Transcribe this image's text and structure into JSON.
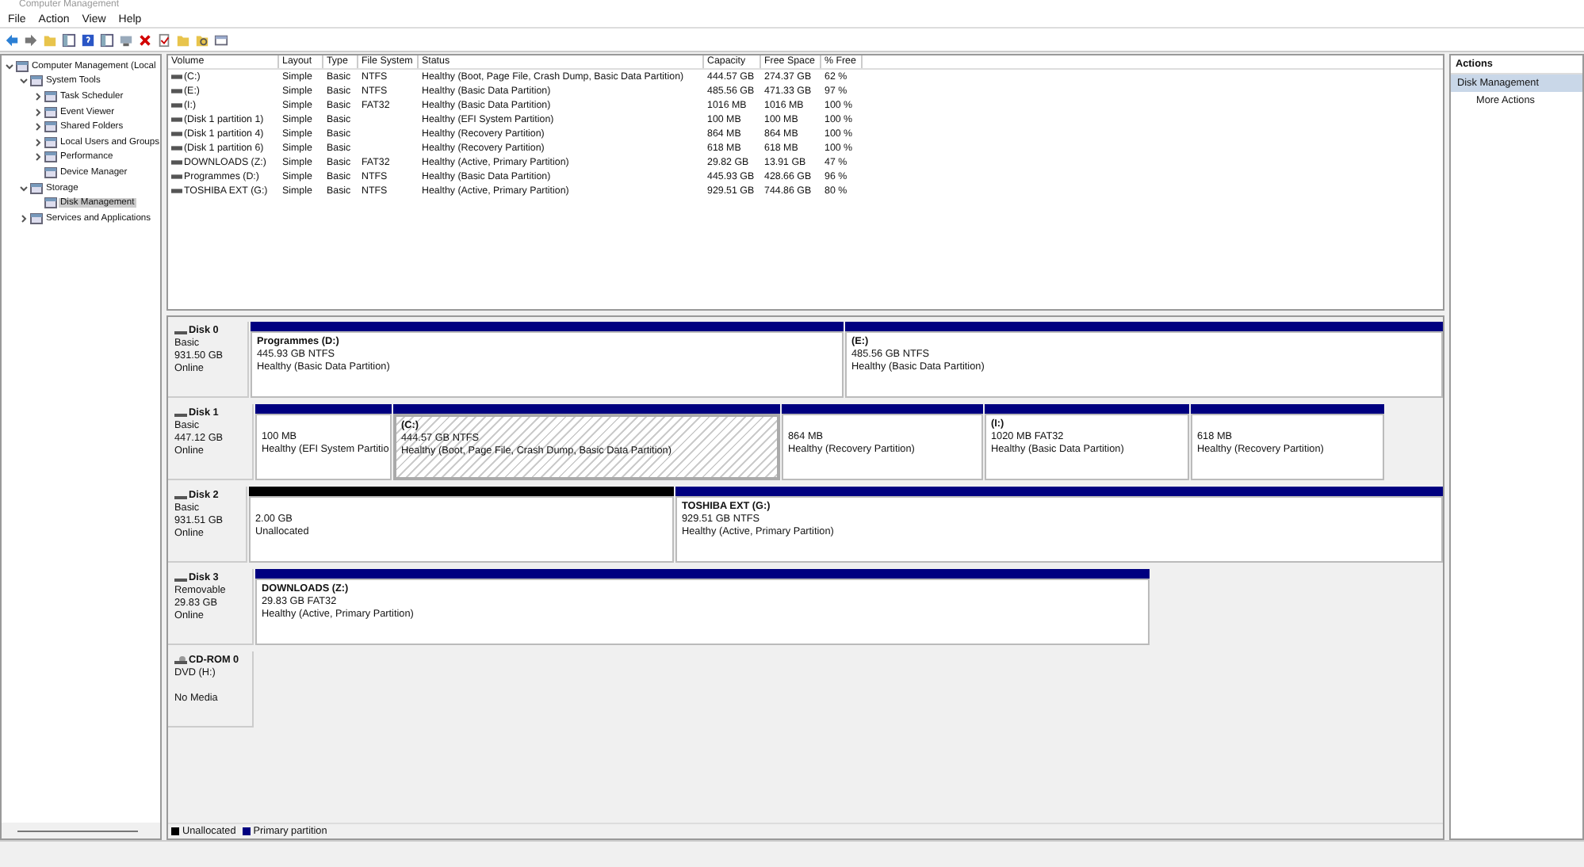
{
  "window": {
    "title": "Computer Management"
  },
  "menu": [
    "File",
    "Action",
    "View",
    "Help"
  ],
  "tree": [
    {
      "label": "Computer Management (Local",
      "expanded": true,
      "selected": false,
      "children": [
        {
          "label": "System Tools",
          "expanded": true,
          "selected": false,
          "children": [
            {
              "label": "Task Scheduler",
              "expanded": false,
              "selected": false
            },
            {
              "label": "Event Viewer",
              "expanded": false,
              "selected": false
            },
            {
              "label": "Shared Folders",
              "expanded": false,
              "selected": false
            },
            {
              "label": "Local Users and Groups",
              "expanded": false,
              "selected": false
            },
            {
              "label": "Performance",
              "expanded": false,
              "selected": false
            },
            {
              "label": "Device Manager",
              "selected": false
            }
          ]
        },
        {
          "label": "Storage",
          "expanded": true,
          "selected": false,
          "children": [
            {
              "label": "Disk Management",
              "selected": true
            }
          ]
        },
        {
          "label": "Services and Applications",
          "expanded": false,
          "selected": false
        }
      ]
    }
  ],
  "volumes": {
    "columns": [
      "Volume",
      "Layout",
      "Type",
      "File System",
      "Status",
      "Capacity",
      "Free Space",
      "% Free"
    ],
    "rows": [
      {
        "volume": "(C:)",
        "layout": "Simple",
        "type": "Basic",
        "file_system": "NTFS",
        "status": "Healthy (Boot, Page File, Crash Dump, Basic Data Partition)",
        "capacity": "444.57 GB",
        "free_space": "274.37 GB",
        "percent_free": "62 %"
      },
      {
        "volume": "(E:)",
        "layout": "Simple",
        "type": "Basic",
        "file_system": "NTFS",
        "status": "Healthy (Basic Data Partition)",
        "capacity": "485.56 GB",
        "free_space": "471.33 GB",
        "percent_free": "97 %"
      },
      {
        "volume": "(I:)",
        "layout": "Simple",
        "type": "Basic",
        "file_system": "FAT32",
        "status": "Healthy (Basic Data Partition)",
        "capacity": "1016 MB",
        "free_space": "1016 MB",
        "percent_free": "100 %"
      },
      {
        "volume": "(Disk 1 partition 1)",
        "layout": "Simple",
        "type": "Basic",
        "status": "Healthy (EFI System Partition)",
        "capacity": "100 MB",
        "free_space": "100 MB",
        "percent_free": "100 %"
      },
      {
        "volume": "(Disk 1 partition 4)",
        "layout": "Simple",
        "type": "Basic",
        "status": "Healthy (Recovery Partition)",
        "capacity": "864 MB",
        "free_space": "864 MB",
        "percent_free": "100 %"
      },
      {
        "volume": "(Disk 1 partition 6)",
        "layout": "Simple",
        "type": "Basic",
        "status": "Healthy (Recovery Partition)",
        "capacity": "618 MB",
        "free_space": "618 MB",
        "percent_free": "100 %"
      },
      {
        "volume": "DOWNLOADS (Z:)",
        "layout": "Simple",
        "type": "Basic",
        "file_system": "FAT32",
        "status": "Healthy (Active, Primary Partition)",
        "capacity": "29.82 GB",
        "free_space": "13.91 GB",
        "percent_free": "47 %"
      },
      {
        "volume": "Programmes (D:)",
        "layout": "Simple",
        "type": "Basic",
        "file_system": "NTFS",
        "status": "Healthy (Basic Data Partition)",
        "capacity": "445.93 GB",
        "free_space": "428.66 GB",
        "percent_free": "96 %"
      },
      {
        "volume": "TOSHIBA EXT (G:)",
        "layout": "Simple",
        "type": "Basic",
        "file_system": "NTFS",
        "status": "Healthy (Active, Primary Partition)",
        "capacity": "929.51 GB",
        "free_space": "744.86 GB",
        "percent_free": "80 %"
      }
    ]
  },
  "disks": [
    {
      "kind": "disk",
      "name": "Disk 0",
      "type": "Basic",
      "size": "931.50 GB",
      "status": "Online",
      "partitions": [
        {
          "kind": "primary",
          "selected": false,
          "name": "Programmes  (D:)",
          "size": "445.93 GB NTFS",
          "status": "Healthy (Basic Data Partition)"
        },
        {
          "kind": "primary",
          "selected": false,
          "name": "(E:)",
          "size": "485.56 GB NTFS",
          "status": "Healthy (Basic Data Partition)"
        }
      ]
    },
    {
      "kind": "disk",
      "name": "Disk 1",
      "type": "Basic",
      "size": "447.12 GB",
      "status": "Online",
      "partitions": [
        {
          "kind": "primary",
          "selected": false,
          "size": "100 MB",
          "status": "Healthy (EFI System Partitio"
        },
        {
          "kind": "primary",
          "selected": true,
          "name": "(C:)",
          "size": "444.57 GB NTFS",
          "status": "Healthy (Boot, Page File, Crash Dump, Basic Data Partition)"
        },
        {
          "kind": "primary",
          "selected": false,
          "size": "864 MB",
          "status": "Healthy (Recovery Partition)"
        },
        {
          "kind": "primary",
          "selected": false,
          "name": "(I:)",
          "size": "1020 MB FAT32",
          "status": "Healthy (Basic Data Partition)"
        },
        {
          "kind": "primary",
          "selected": false,
          "size": "618 MB",
          "status": "Healthy (Recovery Partition)"
        }
      ]
    },
    {
      "kind": "disk",
      "name": "Disk 2",
      "type": "Basic",
      "size": "931.51 GB",
      "status": "Online",
      "partitions": [
        {
          "kind": "unallocated",
          "selected": false,
          "size": "2.00 GB",
          "status": "Unallocated"
        },
        {
          "kind": "primary",
          "selected": false,
          "name": "TOSHIBA EXT  (G:)",
          "size": "929.51 GB NTFS",
          "status": "Healthy (Active, Primary Partition)"
        }
      ]
    },
    {
      "kind": "disk",
      "name": "Disk 3",
      "type": "Removable",
      "size": "29.83 GB",
      "status": "Online",
      "partitions": [
        {
          "kind": "primary",
          "selected": false,
          "name": "DOWNLOADS  (Z:)",
          "size": "29.83 GB FAT32",
          "status": "Healthy (Active, Primary Partition)"
        }
      ]
    },
    {
      "kind": "cdrom",
      "name": "CD-ROM 0",
      "type": "DVD (H:)",
      "status": "No Media"
    }
  ],
  "legend": [
    {
      "label": "Unallocated",
      "color": "#000000"
    },
    {
      "label": "Primary partition",
      "color": "#000080"
    }
  ],
  "actions": {
    "title": "Actions",
    "items": [
      {
        "label": "Disk Management",
        "selected": true
      },
      {
        "label": "More Actions",
        "selected": false
      }
    ]
  }
}
